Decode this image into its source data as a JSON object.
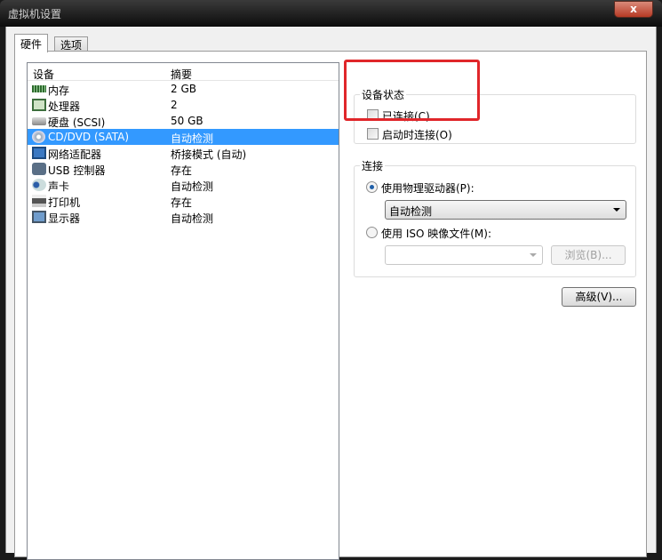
{
  "window": {
    "title": "虚拟机设置",
    "close_label": "x"
  },
  "tabs": [
    {
      "label": "硬件"
    },
    {
      "label": "选项"
    }
  ],
  "devices": {
    "headers": {
      "device": "设备",
      "summary": "摘要"
    },
    "rows": [
      {
        "name": "内存",
        "summary": "2 GB",
        "icon": "memory-icon"
      },
      {
        "name": "处理器",
        "summary": "2",
        "icon": "processor-icon"
      },
      {
        "name": "硬盘 (SCSI)",
        "summary": "50 GB",
        "icon": "harddisk-icon"
      },
      {
        "name": "CD/DVD (SATA)",
        "summary": "自动检测",
        "icon": "cd-dvd-icon",
        "selected": true
      },
      {
        "name": "网络适配器",
        "summary": "桥接模式 (自动)",
        "icon": "network-icon"
      },
      {
        "name": "USB 控制器",
        "summary": "存在",
        "icon": "usb-icon"
      },
      {
        "name": "声卡",
        "summary": "自动检测",
        "icon": "sound-icon"
      },
      {
        "name": "打印机",
        "summary": "存在",
        "icon": "printer-icon"
      },
      {
        "name": "显示器",
        "summary": "自动检测",
        "icon": "display-icon"
      }
    ]
  },
  "device_status": {
    "title": "设备状态",
    "connected": "已连接(C)",
    "connect_at_power_on": "启动时连接(O)"
  },
  "connection": {
    "title": "连接",
    "physical_drive": "使用物理驱动器(P):",
    "physical_drive_value": "自动检测",
    "iso_file": "使用 ISO 映像文件(M):",
    "iso_value": "",
    "browse": "浏览(B)..."
  },
  "advanced": "高级(V)...",
  "colors": {
    "selection": "#3399ff",
    "highlight": "#e0262a"
  }
}
